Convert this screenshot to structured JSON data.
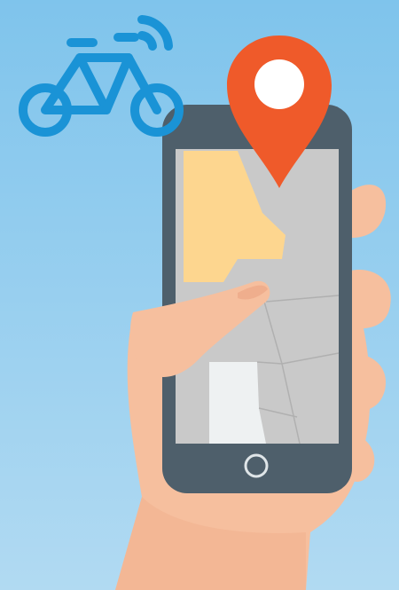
{
  "colors": {
    "sky_top": "#7fc4ec",
    "sky_bottom": "#b1daf2",
    "bike_icon": "#1a93d6",
    "location_pin": "#ef5a2a",
    "phone_body": "#4e5f6b",
    "phone_screen": "#c9c9c9",
    "map_block_yellow": "#fdd68f",
    "map_block_white": "#eef1f2",
    "hand_skin": "#f6bf9e",
    "hand_shadow": "#e8a384"
  },
  "icons": {
    "bike": "bike-wifi-icon",
    "pin": "location-pin-icon",
    "home": "home-button-icon"
  }
}
